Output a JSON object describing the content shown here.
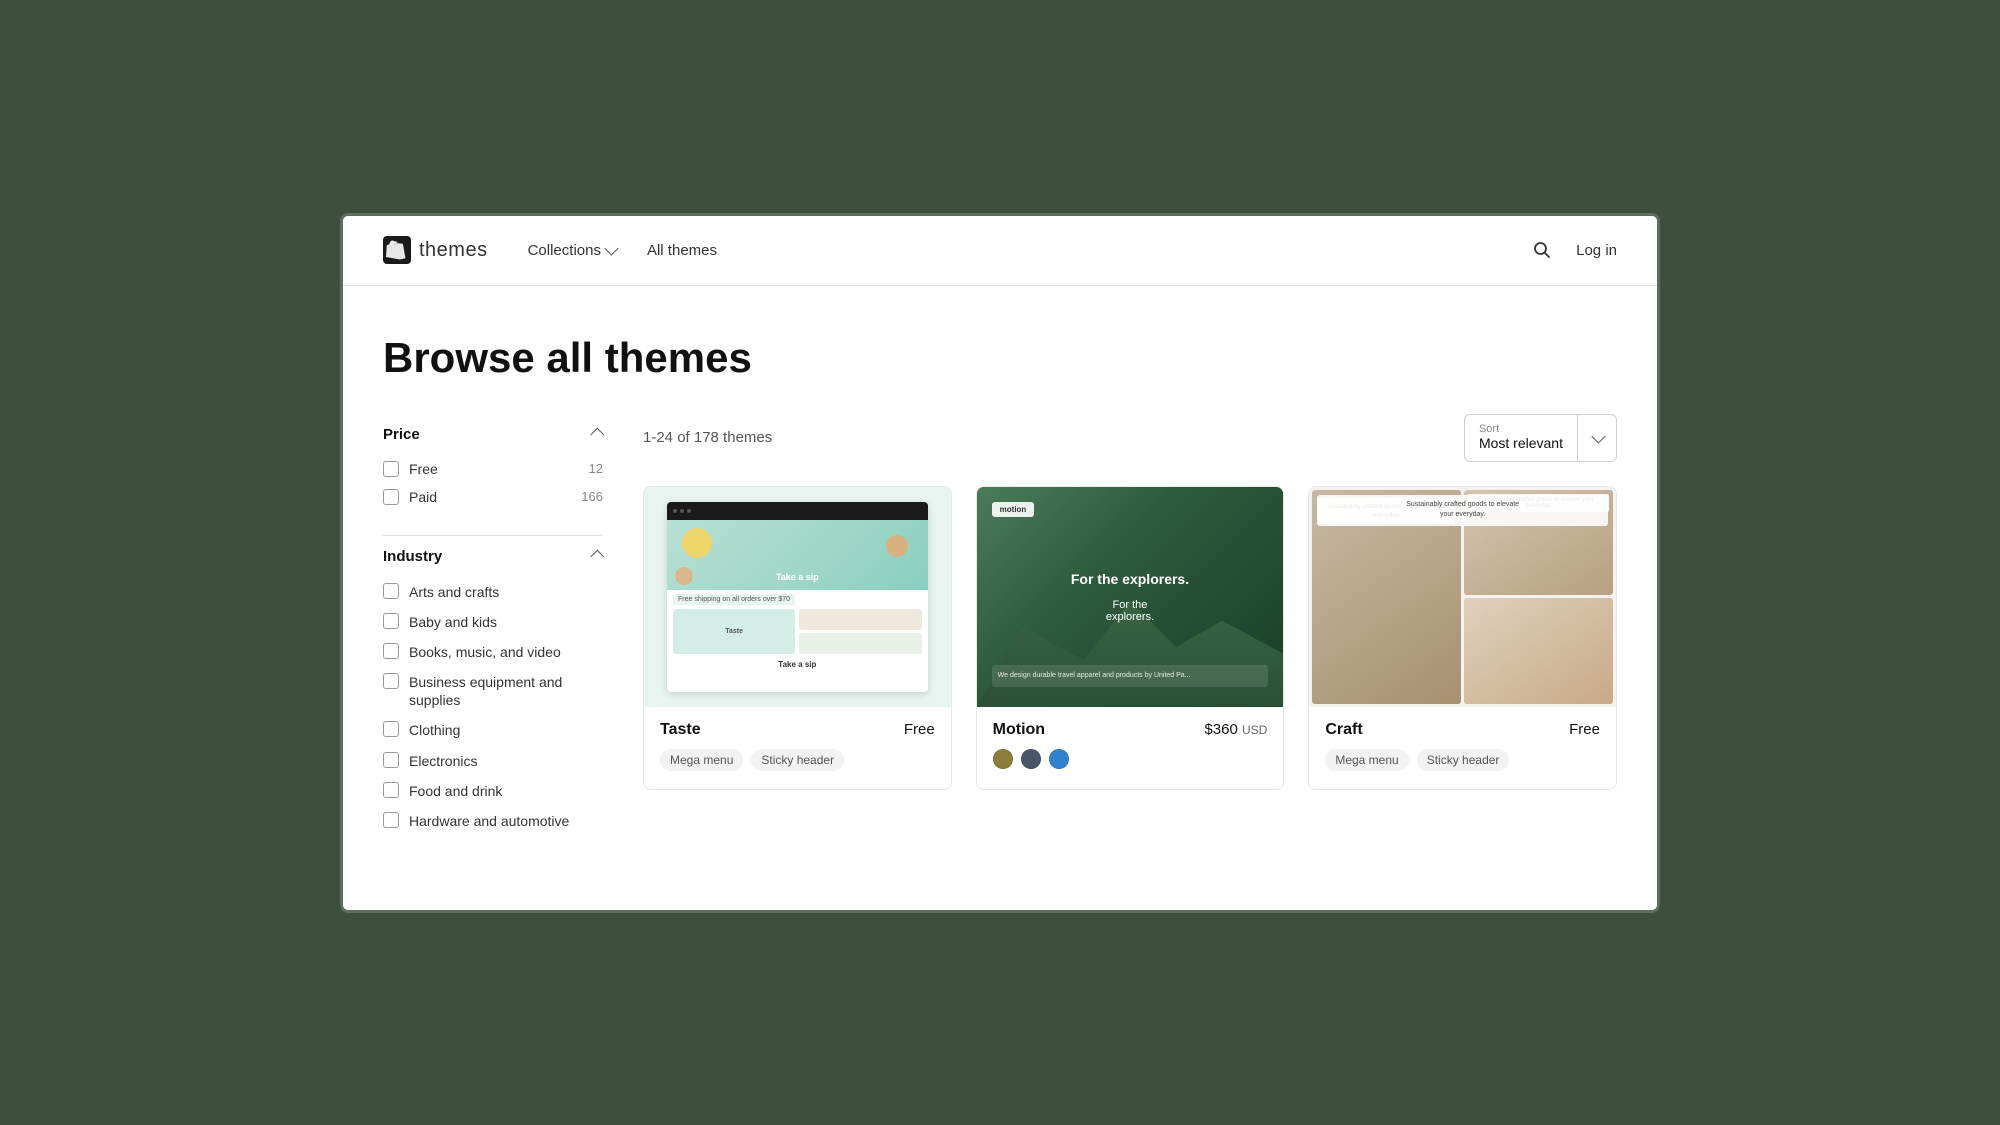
{
  "header": {
    "logo_text": "themes",
    "nav": {
      "collections_label": "Collections",
      "all_themes_label": "All themes"
    },
    "login_label": "Log in"
  },
  "hero": {
    "title": "Browse all themes"
  },
  "sidebar": {
    "price_section": {
      "title": "Price",
      "options": [
        {
          "label": "Free",
          "count": "12"
        },
        {
          "label": "Paid",
          "count": "166"
        }
      ]
    },
    "industry_section": {
      "title": "Industry",
      "options": [
        {
          "label": "Arts and crafts"
        },
        {
          "label": "Baby and kids"
        },
        {
          "label": "Books, music, and video"
        },
        {
          "label": "Business equipment and supplies"
        },
        {
          "label": "Clothing"
        },
        {
          "label": "Electronics"
        },
        {
          "label": "Food and drink"
        },
        {
          "label": "Hardware and automotive"
        }
      ]
    }
  },
  "toolbar": {
    "count_text": "1-24 of 178 themes",
    "sort_label": "Sort",
    "sort_value": "Most relevant"
  },
  "themes": [
    {
      "name": "Taste",
      "price": "Free",
      "price_type": "free",
      "tags": [
        "Mega menu",
        "Sticky header"
      ],
      "swatches": []
    },
    {
      "name": "Motion",
      "price": "$360",
      "price_suffix": "USD",
      "price_type": "paid",
      "tags": [],
      "swatches": [
        "#8b7d3a",
        "#4a5568",
        "#3182ce"
      ]
    },
    {
      "name": "Craft",
      "price": "Free",
      "price_type": "free",
      "tags": [
        "Mega menu",
        "Sticky header"
      ],
      "swatches": []
    }
  ]
}
